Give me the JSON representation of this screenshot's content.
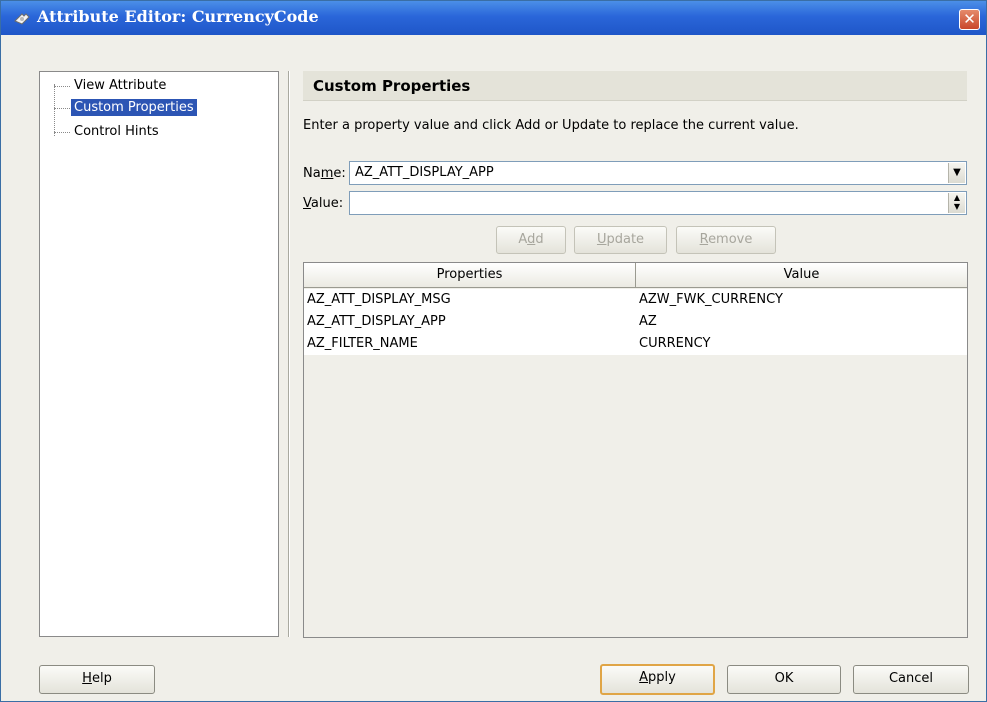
{
  "window": {
    "title": "Attribute Editor: CurrencyCode",
    "close_glyph": "✕",
    "icon": "app-icon"
  },
  "tree": {
    "items": [
      {
        "label": "View Attribute",
        "selected": false
      },
      {
        "label": "Custom Properties",
        "selected": true
      },
      {
        "label": "Control Hints",
        "selected": false
      }
    ]
  },
  "panel": {
    "title": "Custom Properties",
    "instructions": "Enter a property value and click Add or Update to replace the current value.",
    "name": {
      "label_pre": "Na",
      "label_mnemonic": "m",
      "label_post": "e:",
      "value": "AZ_ATT_DISPLAY_APP"
    },
    "value": {
      "label_mnemonic": "V",
      "label_post": "alue:",
      "value": ""
    },
    "buttons": {
      "add": {
        "pre": "A",
        "mnemonic": "d",
        "post": "d"
      },
      "update": {
        "mnemonic": "U",
        "post": "pdate"
      },
      "remove": {
        "mnemonic": "R",
        "post": "emove"
      }
    }
  },
  "table": {
    "columns": [
      "Properties",
      "Value"
    ],
    "rows": [
      {
        "property": "AZ_ATT_DISPLAY_MSG",
        "value": "AZW_FWK_CURRENCY"
      },
      {
        "property": "AZ_ATT_DISPLAY_APP",
        "value": "AZ"
      },
      {
        "property": "AZ_FILTER_NAME",
        "value": "CURRENCY"
      }
    ]
  },
  "footer": {
    "help": {
      "mnemonic": "H",
      "post": "elp"
    },
    "apply": {
      "mnemonic": "A",
      "post": "pply"
    },
    "ok": "OK",
    "cancel": "Cancel"
  },
  "colors": {
    "title_bar": "#2a66d9",
    "selection": "#2c55b4",
    "default_button_border": "#e0a546"
  }
}
